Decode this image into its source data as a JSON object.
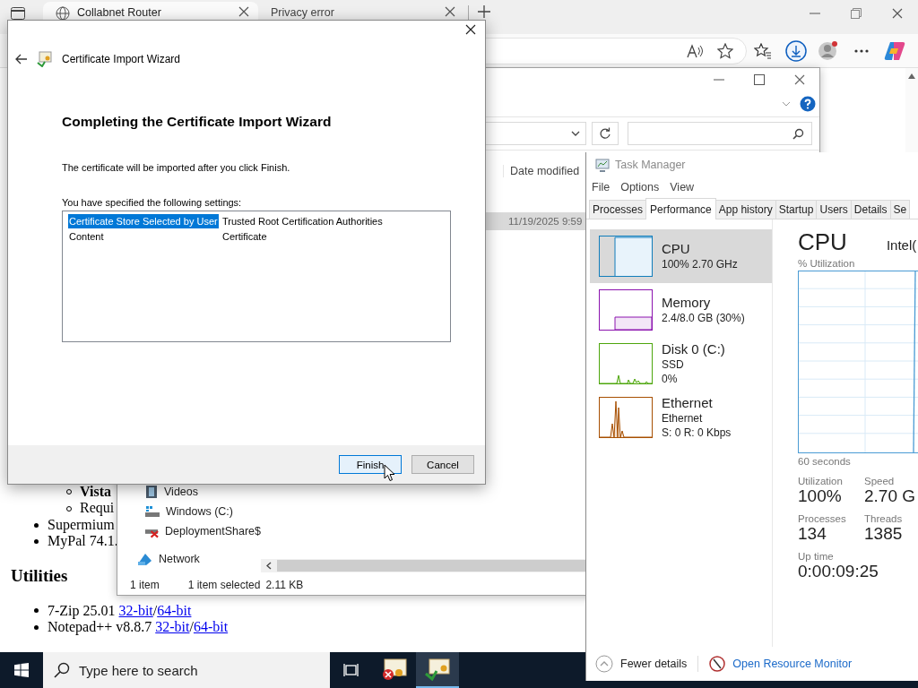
{
  "browser": {
    "tabs": [
      {
        "title": "Collabnet Router",
        "kind": "site",
        "selected": true
      },
      {
        "title": "Privacy error",
        "kind": "blank",
        "selected": false
      }
    ],
    "page": {
      "sub_items": [
        {
          "text": "Vista",
          "bold": true
        },
        {
          "text": "Requi",
          "bold": false
        }
      ],
      "items": [
        "Supermium",
        "MyPal 74.1."
      ],
      "heading": "Utilities",
      "downloads": [
        {
          "name": "7-Zip 25.01",
          "links": [
            "32-bit",
            "64-bit"
          ],
          "separator": "/"
        },
        {
          "name": "Notepad++ v8.8.7",
          "links": [
            "32-bit",
            "64-bit"
          ],
          "separator": "/"
        }
      ]
    }
  },
  "explorer": {
    "column": "Date modified",
    "row_date": "11/19/2025 9:59",
    "this_pc_items": [
      {
        "label": "Videos",
        "kind": "videos"
      },
      {
        "label": "Windows (C:)",
        "kind": "drive"
      },
      {
        "label": "DeploymentShare$",
        "kind": "disconnected"
      }
    ],
    "network": "Network",
    "status": {
      "count": "1 item",
      "selection": "1 item selected",
      "size": "2.11 KB"
    }
  },
  "task_manager": {
    "title": "Task Manager",
    "menu": [
      "File",
      "Options",
      "View"
    ],
    "tabs": [
      {
        "label": "Processes",
        "selected": false
      },
      {
        "label": "Performance",
        "selected": true
      },
      {
        "label": "App history",
        "selected": false
      },
      {
        "label": "Startup",
        "selected": false
      },
      {
        "label": "Users",
        "selected": false
      },
      {
        "label": "Details",
        "selected": false
      },
      {
        "label": "Se",
        "selected": false
      }
    ],
    "resources": [
      {
        "kind": "cpu",
        "name": "CPU",
        "details": [
          "100% 2.70 GHz"
        ],
        "color": "#117dbb",
        "selected": true
      },
      {
        "kind": "memory",
        "name": "Memory",
        "details": [
          "2.4/8.0 GB (30%)"
        ],
        "color": "#8b12ae",
        "selected": false
      },
      {
        "kind": "disk",
        "name": "Disk 0 (C:)",
        "details": [
          "SSD",
          "0%"
        ],
        "color": "#4da60c",
        "selected": false
      },
      {
        "kind": "ethernet",
        "name": "Ethernet",
        "details": [
          "Ethernet",
          "S: 0 R: 0 Kbps"
        ],
        "color": "#a74f01",
        "selected": false
      }
    ],
    "detail": {
      "title": "CPU",
      "model": "Intel(",
      "graph_label": "% Utilization",
      "time_label": "60 seconds",
      "stats": [
        {
          "label": "Utilization",
          "value": "100%"
        },
        {
          "label": "Speed",
          "value": "2.70 G"
        },
        {
          "label": "Processes",
          "value": "134"
        },
        {
          "label": "Threads",
          "value": "1385"
        },
        {
          "label": "Up time",
          "value": "0:00:09:25"
        }
      ]
    },
    "footer": {
      "fewer": "Fewer details",
      "monitor": "Open Resource Monitor"
    }
  },
  "wizard": {
    "title": "Certificate Import Wizard",
    "heading": "Completing the Certificate Import Wizard",
    "message": "The certificate will be imported after you click Finish.",
    "settings_label": "You have specified the following settings:",
    "settings": [
      {
        "name": "Certificate Store Selected by User",
        "value": "Trusted Root Certification Authorities",
        "selected": true
      },
      {
        "name": "Content",
        "value": "Certificate",
        "selected": false
      }
    ],
    "buttons": [
      {
        "label": "Finish",
        "focused": true
      },
      {
        "label": "Cancel",
        "focused": false
      }
    ]
  },
  "taskbar": {
    "search_placeholder": "Type here to search",
    "apps": [
      {
        "kind": "certificate",
        "active": false
      },
      {
        "kind": "import",
        "active": true
      }
    ]
  }
}
